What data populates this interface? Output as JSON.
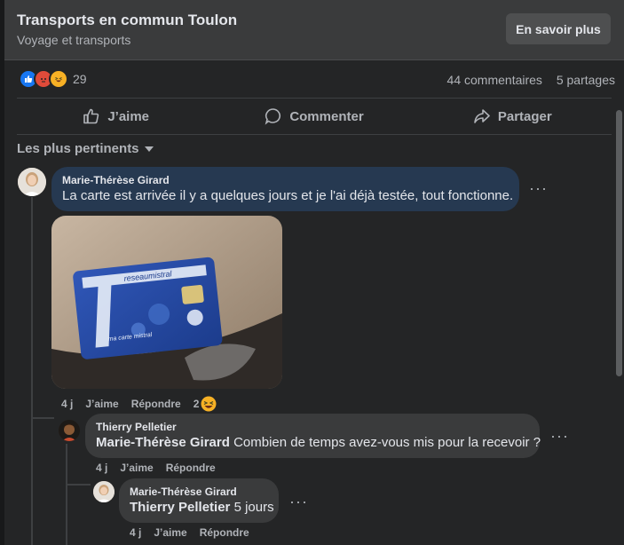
{
  "header": {
    "title": "Transports en commun Toulon",
    "subtitle": "Voyage et transports",
    "learn_more": "En savoir plus"
  },
  "post_stats": {
    "reaction_count": "29",
    "comments": "44 commentaires",
    "shares": "5 partages",
    "reaction_icons": [
      "like-icon",
      "angry-icon",
      "haha-icon"
    ]
  },
  "actions": {
    "like": "J’aime",
    "comment": "Commenter",
    "share": "Partager"
  },
  "sort": {
    "label": "Les plus pertinents"
  },
  "comments": [
    {
      "author": "Marie-Thérèse Girard",
      "text": "La carte est arrivée il y a quelques jours et je l'ai déjà testée, tout fonctionne.",
      "time": "4 j",
      "like": "J’aime",
      "reply": "Répondre",
      "reaction_count": "2",
      "photo": {
        "card_brand": "reseaumistral",
        "card_label": "ma carte mistral"
      }
    },
    {
      "author": "Thierry Pelletier",
      "mention": "Marie-Thérèse Girard",
      "text": "Combien de temps avez-vous mis pour la recevoir ?",
      "time": "4 j",
      "like": "J’aime",
      "reply": "Répondre"
    },
    {
      "author": "Marie-Thérèse Girard",
      "mention": "Thierry Pelletier",
      "text": "5 jours",
      "time": "4 j",
      "like": "J’aime",
      "reply": "Répondre"
    }
  ],
  "more_menu": "···",
  "colors": {
    "panel": "#242526",
    "header": "#3a3b3c",
    "bubble": "#3a3b3c",
    "highlighted_bubble": "#263951",
    "accent": "#1877f2"
  }
}
